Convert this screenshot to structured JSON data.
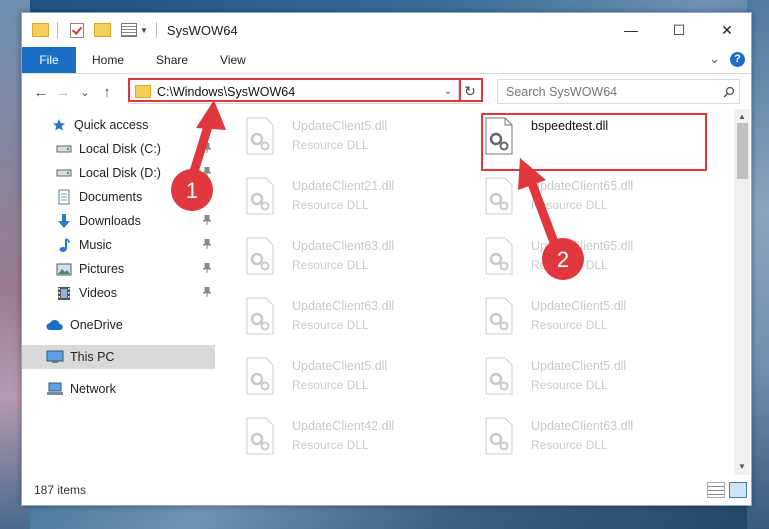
{
  "window": {
    "title": "SysWOW64",
    "controls": {
      "minimize": "—",
      "maximize": "☐",
      "close": "✕"
    }
  },
  "ribbon": {
    "tabs": [
      "File",
      "Home",
      "Share",
      "View"
    ],
    "expand_glyph": "⌄",
    "help_label": "?"
  },
  "navigation": {
    "back": "←",
    "forward": "→",
    "recent": "⌄",
    "up": "↑",
    "address": "C:\\Windows\\SysWOW64",
    "address_dropdown": "⌄",
    "refresh": "↻",
    "search_placeholder": "Search SysWOW64"
  },
  "sidebar": {
    "items": [
      {
        "label": "Quick access",
        "icon": "star-icon"
      },
      {
        "label": "Local Disk (C:)",
        "icon": "drive-icon",
        "pinned": true
      },
      {
        "label": "Local Disk (D:)",
        "icon": "drive-icon",
        "pinned": true
      },
      {
        "label": "Documents",
        "icon": "documents-icon",
        "pinned": true
      },
      {
        "label": "Downloads",
        "icon": "download-icon",
        "pinned": true
      },
      {
        "label": "Music",
        "icon": "music-icon",
        "pinned": true
      },
      {
        "label": "Pictures",
        "icon": "pictures-icon",
        "pinned": true
      },
      {
        "label": "Videos",
        "icon": "videos-icon",
        "pinned": true
      },
      {
        "label": "OneDrive",
        "icon": "cloud-icon"
      },
      {
        "label": "This PC",
        "icon": "computer-icon",
        "selected": true
      },
      {
        "label": "Network",
        "icon": "network-icon"
      }
    ]
  },
  "files": {
    "left_column": [
      {
        "name": "UpdateClient5.dll",
        "type": "Resource DLL"
      },
      {
        "name": "UpdateClient21.dll",
        "type": "Resource DLL"
      },
      {
        "name": "UpdateClient63.dll",
        "type": "Resource DLL"
      },
      {
        "name": "UpdateClient63.dll",
        "type": "Resource DLL"
      },
      {
        "name": "UpdateClient5.dll",
        "type": "Resource DLL"
      },
      {
        "name": "UpdateClient42.dll",
        "type": "Resource DLL"
      }
    ],
    "right_column": [
      {
        "name": "bspeedtest.dll",
        "type": "",
        "highlighted": true
      },
      {
        "name": "UpdateClient65.dll",
        "type": "Resource DLL"
      },
      {
        "name": "UpdateClient65.dll",
        "type": "Resource DLL"
      },
      {
        "name": "UpdateClient5.dll",
        "type": "Resource DLL"
      },
      {
        "name": "UpdateClient5.dll",
        "type": "Resource DLL"
      },
      {
        "name": "UpdateClient63.dll",
        "type": "Resource DLL"
      }
    ]
  },
  "status": {
    "item_count": "187 items"
  },
  "annotations": {
    "step1": "1",
    "step2": "2",
    "highlight_color": "#e0383e"
  }
}
